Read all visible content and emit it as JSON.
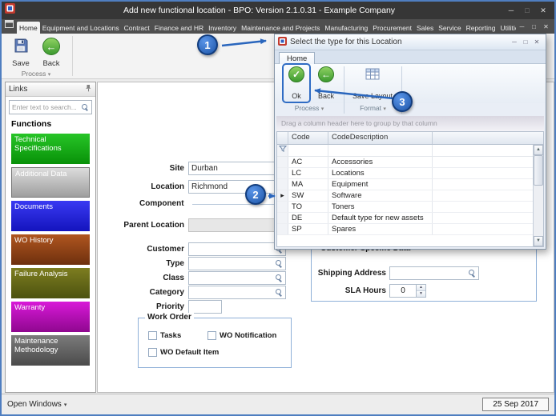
{
  "window": {
    "title": "Add new functional location - BPO: Version 2.1.0.31 - Example Company"
  },
  "glyphs": {
    "minimize": "─",
    "maximize": "□",
    "close": "✕",
    "caret": "▾",
    "spin_up": "▲",
    "spin_down": "▼",
    "row_indicator": "▸",
    "back_arrow": "←",
    "check": "✓"
  },
  "ribbon": {
    "tabs": [
      "Home",
      "Equipment and Locations",
      "Contract",
      "Finance and HR",
      "Inventory",
      "Maintenance and Projects",
      "Manufacturing",
      "Procurement",
      "Sales",
      "Service",
      "Reporting",
      "Utilities"
    ],
    "active_tab": "Home",
    "save_label": "Save",
    "back_label": "Back",
    "group_label": "Process"
  },
  "links": {
    "title": "Links",
    "search_placeholder": "Enter text to search...",
    "heading": "Functions",
    "items": [
      {
        "label": "Technical Specifications",
        "color": "#12b212"
      },
      {
        "label": "Additional Data",
        "color": "#b8b8b8",
        "selected": true
      },
      {
        "label": "Documents",
        "color": "#2626e8"
      },
      {
        "label": "WO History",
        "color": "#9c4f1d"
      },
      {
        "label": "Failure Analysis",
        "color": "#667112"
      },
      {
        "label": "Warranty",
        "color": "#cf12cf"
      },
      {
        "label": "Maintenance Methodology",
        "color": "#6b6b6b"
      }
    ]
  },
  "form": {
    "site_label": "Site",
    "site_value": "Durban",
    "location_label": "Location",
    "location_value": "Richmond",
    "component_label": "Component",
    "parent_location_label": "Parent Location",
    "customer_label": "Customer",
    "type_label": "Type",
    "class_label": "Class",
    "category_label": "Category",
    "priority_label": "Priority",
    "work_order": {
      "title": "Work Order",
      "cb": [
        "Tasks",
        "WO Notification",
        "WO Default Item"
      ]
    },
    "customer_specific": {
      "title": "Customer Specific Data",
      "shipping_label": "Shipping Address",
      "sla_label": "SLA Hours",
      "sla_value": "0"
    }
  },
  "dialog": {
    "title": "Select the type for this Location",
    "tab_home": "Home",
    "ok_label": "Ok",
    "back_label": "Back",
    "save_layout_label": "Save Layout",
    "group_process": "Process",
    "group_format": "Format",
    "group_by_hint": "Drag a column header here to group by that column",
    "col_code": "Code",
    "col_desc": "CodeDescription",
    "rows": [
      {
        "code": "AC",
        "desc": "Accessories"
      },
      {
        "code": "LC",
        "desc": "Locations"
      },
      {
        "code": "MA",
        "desc": "Equipment"
      },
      {
        "code": "SW",
        "desc": "Software",
        "focused": true
      },
      {
        "code": "TO",
        "desc": "Toners"
      },
      {
        "code": "DE",
        "desc": "Default type for new assets"
      },
      {
        "code": "SP",
        "desc": "Spares"
      }
    ]
  },
  "callouts": {
    "one": "1",
    "two": "2",
    "three": "3"
  },
  "status": {
    "open_windows": "Open Windows",
    "date": "25 Sep 2017"
  },
  "colors": {
    "callout_blue": "#2f6cc4",
    "highlight_blue": "#2a66bd"
  }
}
